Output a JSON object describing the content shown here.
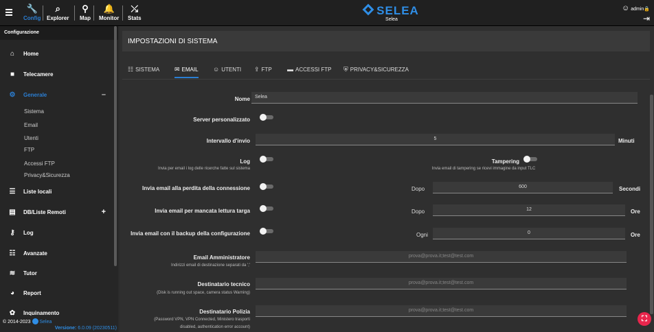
{
  "topbar": {
    "buttons": [
      {
        "label": "Config",
        "icon": "wrench-icon"
      },
      {
        "label": "Explorer",
        "icon": "explorer-icon"
      },
      {
        "label": "Map",
        "icon": "map-pin-icon"
      },
      {
        "label": "Monitor",
        "icon": "bell-icon"
      },
      {
        "label": "Stats",
        "icon": "stats-icon"
      }
    ],
    "brand": "SELEA",
    "brand_sub": "Selea",
    "user": "admin",
    "accent": "#2b7fd4"
  },
  "sidebar": {
    "title": "Configurazione",
    "items": [
      {
        "label": "Home",
        "icon": "home-icon"
      },
      {
        "label": "Telecamere",
        "icon": "camera-icon"
      },
      {
        "label": "Generale",
        "icon": "gear-icon",
        "action": "–"
      },
      {
        "label": "Liste locali",
        "icon": "list-icon"
      },
      {
        "label": "DB/Liste Remoti",
        "icon": "db-icon",
        "action": "+"
      },
      {
        "label": "Log",
        "icon": "key-icon"
      },
      {
        "label": "Avanzate",
        "icon": "sliders-icon"
      },
      {
        "label": "Tutor",
        "icon": "signal-icon"
      },
      {
        "label": "Report",
        "icon": "pie-icon"
      },
      {
        "label": "Inquinamento",
        "icon": "pollution-icon"
      }
    ],
    "subitems": [
      "Sistema",
      "Email",
      "Utenti",
      "FTP",
      "Accessi FTP",
      "Privacy&Sicurezza"
    ],
    "copyright": "© 2014-2023",
    "copyright_brand": "Selea",
    "version_label": "Versione:",
    "version": "6.0.09 (20230511)"
  },
  "main": {
    "title": "IMPOSTAZIONI DI SISTEMA",
    "tabs": [
      {
        "label": "SISTEMA",
        "icon": "sliders-icon"
      },
      {
        "label": "EMAIL",
        "icon": "envelope-icon"
      },
      {
        "label": "UTENTI",
        "icon": "user-circle-icon"
      },
      {
        "label": "FTP",
        "icon": "upload-icon"
      },
      {
        "label": "ACCESSI FTP",
        "icon": "folder-icon"
      },
      {
        "label": "PRIVACY&SICUREZZA",
        "icon": "shield-icon"
      }
    ],
    "form": {
      "nome_label": "Nome",
      "nome_value": "Selea",
      "server_label": "Server personalizzato",
      "intervallo_label": "Intervallo d'invio",
      "intervallo_value": "5",
      "intervallo_unit": "Minuti",
      "log_label": "Log",
      "log_hint": "Invia per email i log delle ricerche fatte sul sistema",
      "tampering_label": "Tampering",
      "tampering_hint": "Invia email di tampering se ricevi immagine da input TLC",
      "perdita_label": "Invia email alla perdita della connessione",
      "perdita_pre": "Dopo",
      "perdita_value": "600",
      "perdita_unit": "Secondi",
      "lettura_label": "Invia email per mancata lettura targa",
      "lettura_pre": "Dopo",
      "lettura_value": "12",
      "lettura_unit": "Ore",
      "backup_label": "Invia email con il backup della configurazione",
      "backup_pre": "Ogni",
      "backup_value": "0",
      "backup_unit": "Ore",
      "admin_label": "Email Amministratore",
      "admin_hint": "Indirizzi email di destinazione separati da ';'",
      "admin_placeholder": "prova@prova.it;test@test.com",
      "tecnico_label": "Destinatario tecnico",
      "tecnico_hint": "(Disk is running out space, camera status Warning)",
      "tecnico_placeholder": "prova@prova.it;test@test.com",
      "polizia_label": "Destinatario Polizia",
      "polizia_hint1": "(Password VPN, VPN Connected, Ministero trasporti",
      "polizia_hint2": "disabled, authentication error account)",
      "polizia_placeholder": "prova@prova.it;test@test.com"
    }
  }
}
